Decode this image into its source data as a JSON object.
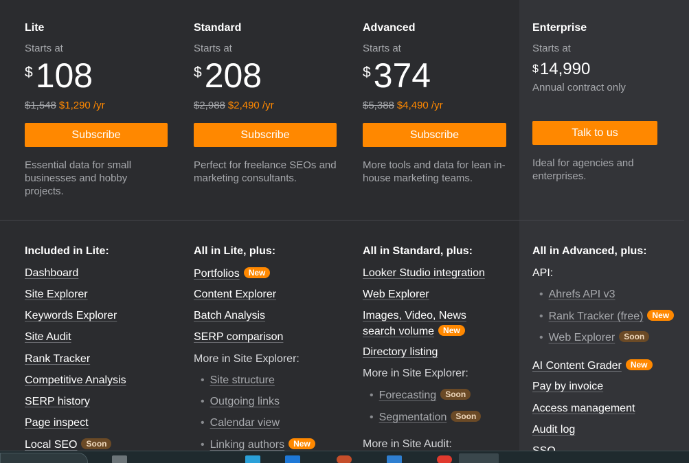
{
  "plans": [
    {
      "name": "Lite",
      "starts": "Starts at",
      "currency": "$",
      "price": "108",
      "old_price": "$1,548",
      "new_price": "$1,290 /yr",
      "button": "Subscribe",
      "desc": "Essential data for small businesses and hobby projects.",
      "features_head": "Included in Lite:",
      "features": [
        {
          "label": "Dashboard"
        },
        {
          "label": "Site Explorer"
        },
        {
          "label": "Keywords Explorer"
        },
        {
          "label": "Site Audit"
        },
        {
          "label": "Rank Tracker"
        },
        {
          "label": "Competitive Analysis"
        },
        {
          "label": "SERP history"
        },
        {
          "label": "Page inspect"
        },
        {
          "label": "Local SEO",
          "badge": "Soon"
        }
      ]
    },
    {
      "name": "Standard",
      "starts": "Starts at",
      "currency": "$",
      "price": "208",
      "old_price": "$2,988",
      "new_price": "$2,490 /yr",
      "button": "Subscribe",
      "desc": "Perfect for freelance SEOs and marketing consultants.",
      "features_head": "All in Lite, plus:",
      "features": [
        {
          "label": "Portfolios",
          "badge": "New"
        },
        {
          "label": "Content Explorer"
        },
        {
          "label": "Batch Analysis"
        },
        {
          "label": "SERP comparison"
        },
        {
          "label": "More in Site Explorer:"
        },
        {
          "label": "Site structure"
        },
        {
          "label": "Outgoing links"
        },
        {
          "label": "Calendar view"
        },
        {
          "label": "Linking authors",
          "badge": "New"
        }
      ]
    },
    {
      "name": "Advanced",
      "starts": "Starts at",
      "currency": "$",
      "price": "374",
      "old_price": "$5,388",
      "new_price": "$4,490 /yr",
      "button": "Subscribe",
      "desc": "More tools and data for lean in-house marketing teams.",
      "features_head": "All in Standard, plus:",
      "features": [
        {
          "label": "Looker Studio integration"
        },
        {
          "label": "Web Explorer"
        },
        {
          "label": "Images, Video, News",
          "label2": "search volume",
          "badge": "New"
        },
        {
          "label": "Directory listing"
        },
        {
          "label": "More in Site Explorer:"
        },
        {
          "label": "Forecasting",
          "badge": "Soon"
        },
        {
          "label": "Segmentation",
          "badge": "Soon"
        },
        {
          "label": "More in Site Audit:"
        }
      ]
    },
    {
      "name": "Enterprise",
      "starts": "Starts at",
      "currency": "$",
      "price": "14,990",
      "annual": "Annual contract only",
      "button": "Talk to us",
      "desc": "Ideal for agencies and enterprises.",
      "features_head": "All in Advanced, plus:",
      "features": [
        {
          "label": "API:"
        },
        {
          "label": "Ahrefs API v3"
        },
        {
          "label": "Rank Tracker (free)",
          "badge": "New"
        },
        {
          "label": "Web Explorer",
          "badge": "Soon"
        },
        {
          "label": "AI Content Grader",
          "badge": "New"
        },
        {
          "label": "Pay by invoice"
        },
        {
          "label": "Access management"
        },
        {
          "label": "Audit log"
        },
        {
          "label": "SSO"
        }
      ]
    }
  ],
  "colors": {
    "accent": "#ff8800",
    "background": "#2b2c2f",
    "muted": "#a7a9ad"
  }
}
